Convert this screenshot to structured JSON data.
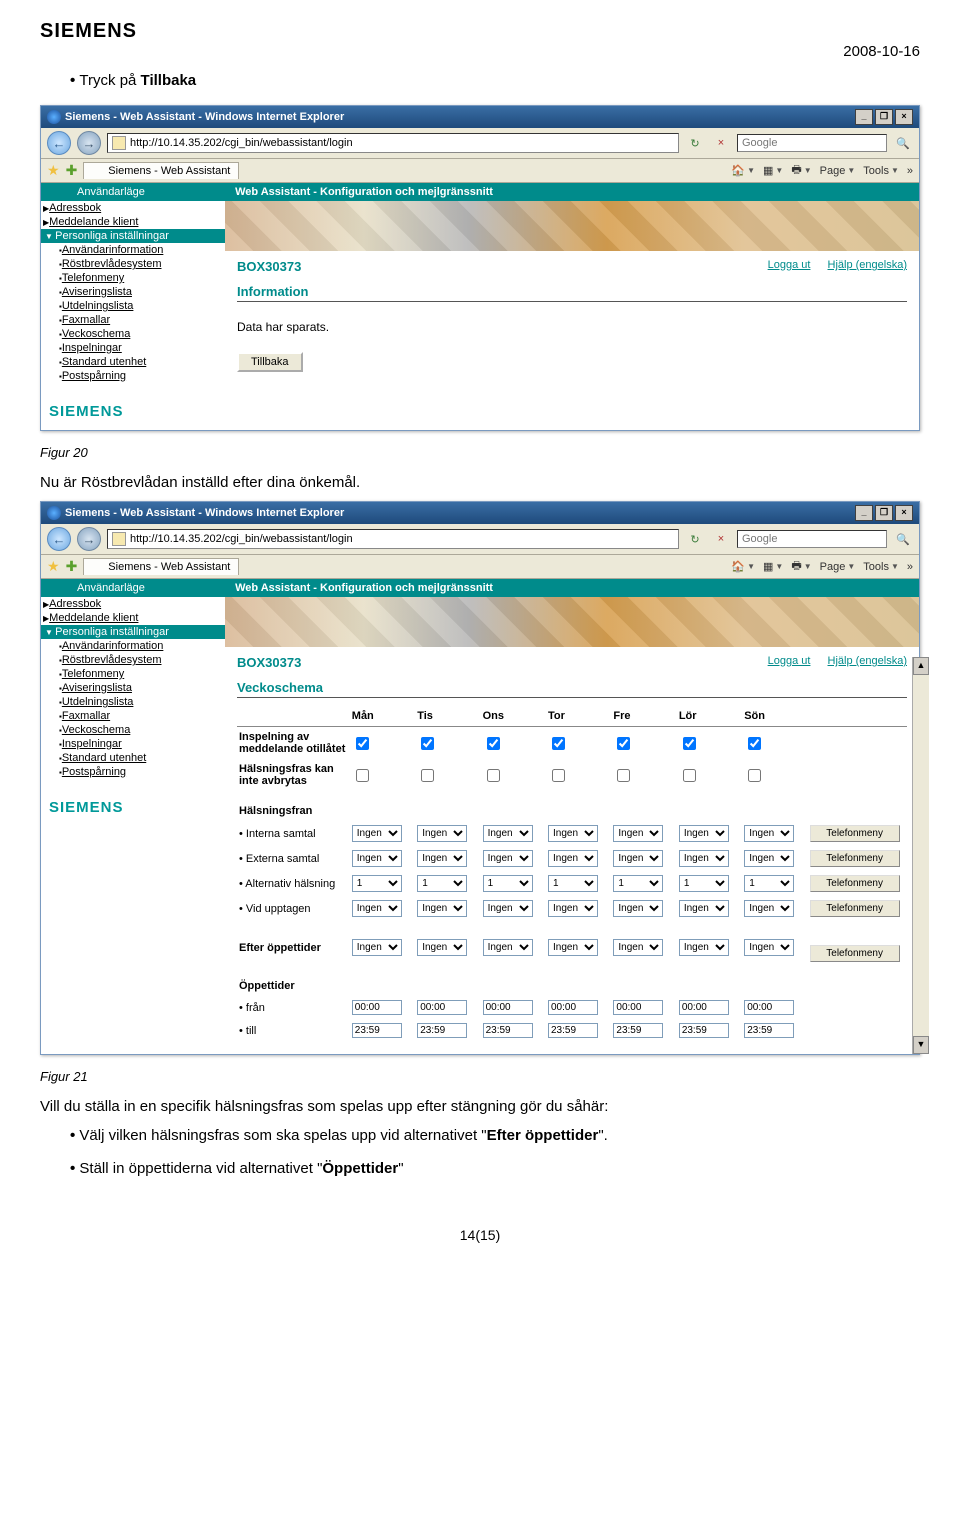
{
  "header": {
    "logo": "SIEMENS",
    "date": "2008-10-16",
    "bullet1_pre": "Tryck på ",
    "bullet1_bold": "Tillbaka"
  },
  "browser": {
    "title": "Siemens - Web Assistant - Windows Internet Explorer",
    "url": "http://10.14.35.202/cgi_bin/webassistant/login",
    "search_placeholder": "Google",
    "tab": "Siemens - Web Assistant",
    "tool_page": "Page",
    "tool_tools": "Tools",
    "teal_left": "Användarläge",
    "teal_right": "Web Assistant - Konfiguration och mejlgränssnitt"
  },
  "sidebar": {
    "top1": "Adressbok",
    "top2": "Meddelande klient",
    "sel": "Personliga inställningar",
    "subs": [
      "Användarinformation",
      "Röstbrevlådesystem",
      "Telefonmeny",
      "Aviseringslista",
      "Utdelningslista",
      "Faxmallar",
      "Veckoschema",
      "Inspelningar",
      "Standard utenhet",
      "Postspårning"
    ],
    "logo": "SIEMENS"
  },
  "shot1": {
    "boxid": "BOX30373",
    "logout": "Logga ut",
    "help": "Hjälp (engelska)",
    "section": "Information",
    "saved": "Data har sparats.",
    "back_btn": "Tillbaka"
  },
  "mid": {
    "caption": "Figur 20",
    "text": "Nu är Röstbrevlådan inställd efter dina önkemål."
  },
  "shot2": {
    "section": "Veckoschema",
    "days": [
      "Mån",
      "Tis",
      "Ons",
      "Tor",
      "Fre",
      "Lör",
      "Sön"
    ],
    "row1": "Inspelning av meddelande otillåtet",
    "row2": "Hälsningsfras kan inte avbrytas",
    "group": "Hälsningsfran",
    "r_int": "• Interna samtal",
    "r_ext": "• Externa samtal",
    "r_alt": "• Alternativ hälsning",
    "r_bus": "• Vid upptagen",
    "r_after": "Efter öppettider",
    "r_open": "Öppettider",
    "r_from": "• från",
    "r_to": "• till",
    "opt_ingen": "Ingen",
    "opt_one": "1",
    "time_from": "00:00",
    "time_to": "23:59",
    "menu_btn": "Telefonmeny"
  },
  "foot": {
    "caption": "Figur 21",
    "p1": "Vill du ställa in en specifik hälsningsfras som spelas upp efter stängning gör du såhär:",
    "b1_pre": "Välj vilken hälsningsfras som ska spelas upp vid alternativet \"",
    "b1_bold": "Efter öppettider",
    "b1_post": "\".",
    "b2_pre": "Ställ in öppettiderna vid alternativet \"",
    "b2_bold": "Öppettider",
    "b2_post": "\"",
    "pagenum": "14(15)"
  }
}
